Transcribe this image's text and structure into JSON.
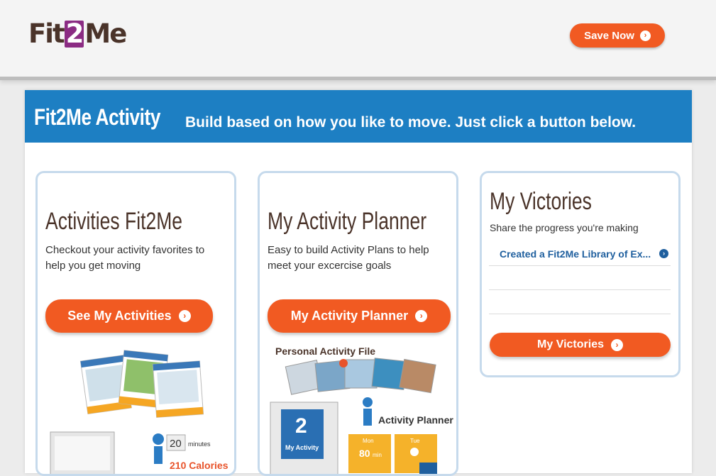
{
  "header": {
    "logo": {
      "prefix": "Fit",
      "number": "2",
      "suffix": "Me"
    },
    "save_label": "Save Now",
    "colors": {
      "accent": "#f15a22",
      "brand_purple": "#8b2c83",
      "header_blue": "#1d7fc3"
    }
  },
  "panel": {
    "title": "Fit2Me Activity",
    "subtitle": "Build based on how you like to move. Just click a button below."
  },
  "cards": [
    {
      "title": "Activities Fit2Me",
      "description": "Checkout your activity favorites to help you get moving",
      "button": "See My Activities",
      "illustration": {
        "stepper_value": "20",
        "stepper_unit": "minutes",
        "calories": "210 Calories"
      }
    },
    {
      "title": "My Activity Planner",
      "description": "Easy to build Activity Plans to help meet your excercise goals",
      "button": "My Activity Planner",
      "illustration": {
        "file_label": "Personal Activity File",
        "planner_label": "Activity Planner",
        "folder_number": "2",
        "folder_label": "My Activity",
        "day1": "Mon",
        "day1_value": "80",
        "day1_unit": "min",
        "day2": "Tue"
      }
    },
    {
      "title": "My Victories",
      "description": "Share the progress you're making",
      "items": [
        "Created a Fit2Me Library of Ex...",
        "",
        ""
      ],
      "button": "My Victories"
    }
  ]
}
